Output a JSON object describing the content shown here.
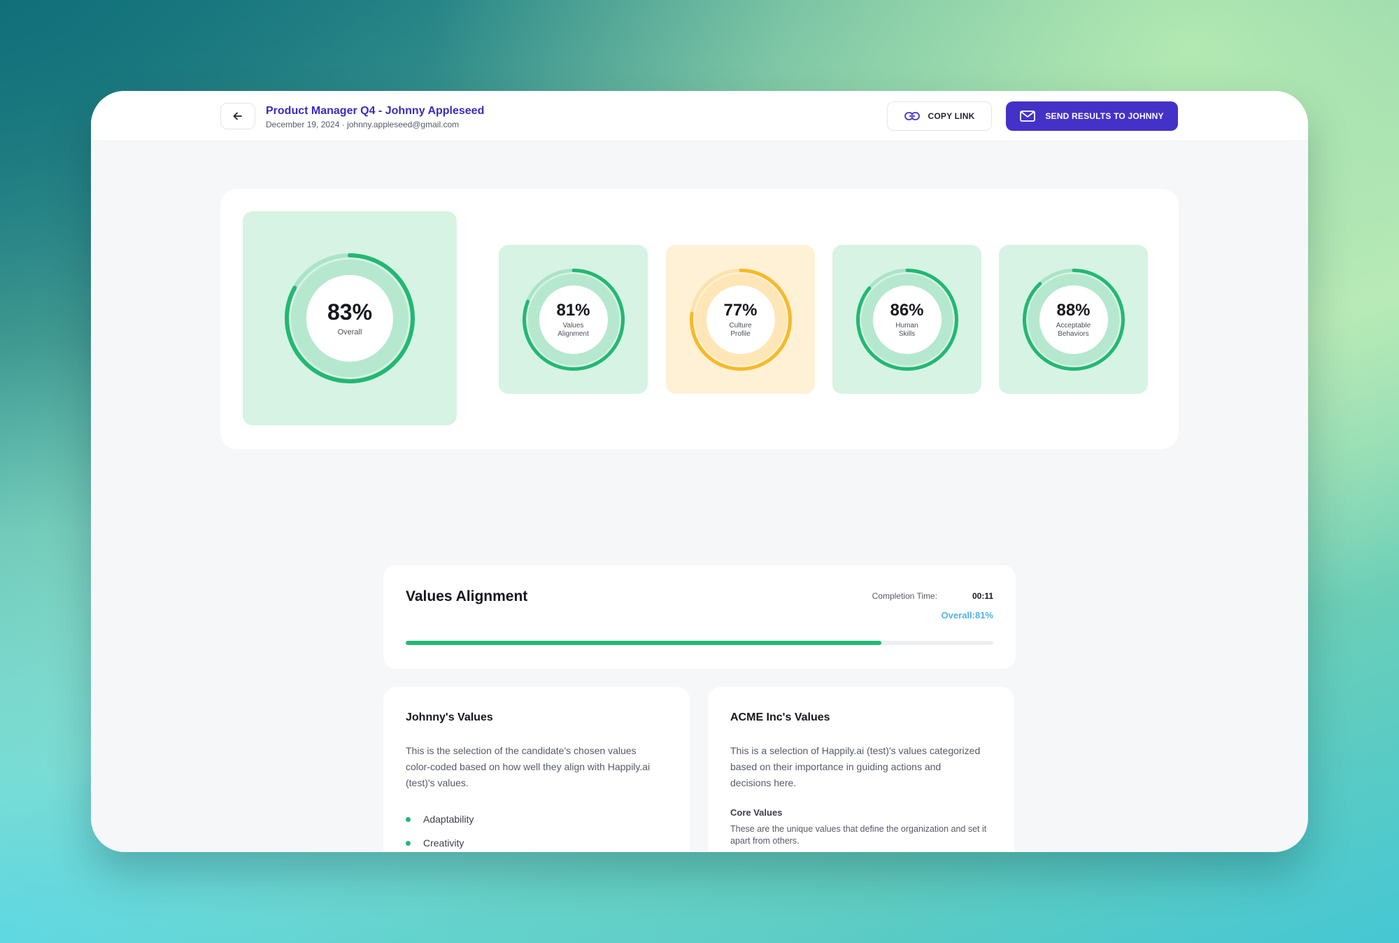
{
  "header": {
    "title": "Product Manager Q4 - Johnny Appleseed",
    "subtitle": "December 19, 2024 · johnny.appleseed@gmail.com",
    "copy_link_label": "COPY LINK",
    "send_results_label": "SEND RESULTS TO JOHNNY"
  },
  "scores": {
    "overall": {
      "value": "83%",
      "label": "Overall",
      "progress": 0.83,
      "color": "#22b873"
    },
    "values_alignment": {
      "value": "81%",
      "label": "Values Alignment",
      "progress": 0.81,
      "color": "#22b873"
    },
    "culture_profile": {
      "value": "77%",
      "label": "Culture Profile",
      "progress": 0.77,
      "color": "#f7b928"
    },
    "human_skills": {
      "value": "86%",
      "label": "Human Skills",
      "progress": 0.86,
      "color": "#22b873"
    },
    "acceptable_behaviors": {
      "value": "88%",
      "label": "Acceptable Behaviors",
      "progress": 0.88,
      "color": "#22b873"
    }
  },
  "values_alignment": {
    "title": "Values Alignment",
    "completion_label": "Completion Time:",
    "completion_value": "00:11",
    "overall_label": "Overall:81%",
    "progress": 0.81
  },
  "candidate_values": {
    "title": "Johnny's Values",
    "description": "This is the selection of the candidate's chosen values color-coded based on how well they align with Happily.ai (test)'s values.",
    "items": [
      "Adaptability",
      "Creativity"
    ]
  },
  "company_values": {
    "title": "ACME Inc's Values",
    "description": "This is a selection of Happily.ai (test)'s values categorized based on their importance in guiding actions and decisions here.",
    "core_title": "Core Values",
    "core_description": "These are the unique values that define the organization and set it apart from others."
  }
}
